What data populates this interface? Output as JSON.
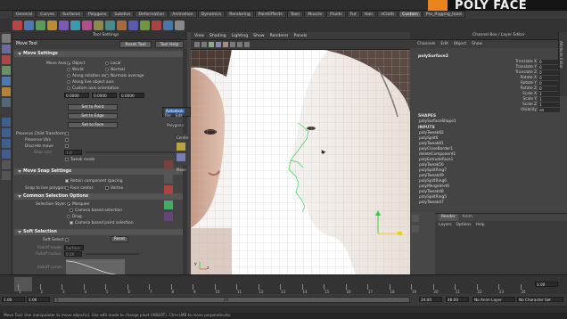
{
  "brand": {
    "logo_text": "POLY FACE",
    "accent": "#e9831e"
  },
  "shelf": {
    "tabs": [
      "General",
      "Curves",
      "Surfaces",
      "Polygons",
      "Subdivs",
      "Deformation",
      "Animation",
      "Dynamics",
      "Rendering",
      "PaintEffects",
      "Toon",
      "Muscle",
      "Fluids",
      "Fur",
      "Hair",
      "nCloth",
      "Custom",
      "Pro_Rigging_tools"
    ],
    "active_tab": "Custom"
  },
  "tool_settings": {
    "panel_title": "Tool Settings",
    "tool_name": "Move Tool",
    "reset_label": "Reset Tool",
    "help_label": "Tool Help",
    "move_settings": {
      "header": "Move Settings",
      "move_axis_label": "Move Axis:",
      "axis_options": [
        "Object",
        "World",
        "Along rotation axis",
        "Along live object axis",
        "Custom axis orientation"
      ],
      "axis_options_right": [
        "Local",
        "Normal",
        "Normals average"
      ],
      "custom_values": [
        "0.0000",
        "0.0000",
        "0.0000"
      ],
      "set_to_point": "Set to Point",
      "set_to_edge": "Set to Edge",
      "set_to_face": "Set to Face",
      "preserve_child": "Preserve Child Transform",
      "preserve_uvs": "Preserve UVs",
      "discrete_move": "Discrete move",
      "step_size_label": "Step size",
      "step_size_value": "1.0",
      "tweak_mode": "Tweak mode"
    },
    "move_snap": {
      "header": "Move Snap Settings",
      "retain_spacing": "Retain component spacing",
      "snap_live_label": "Snap to live polygon:",
      "face_center": "Face center",
      "vertex": "Vertex"
    },
    "common_selection": {
      "header": "Common Selection Options",
      "selection_style_label": "Selection Style:",
      "marquee": "Marquee",
      "camera_based": "Camera based selection",
      "drag": "Drag",
      "camera_based_paint": "Camera based paint selection"
    },
    "soft_selection": {
      "header": "Soft Selection",
      "soft_select": "Soft Select",
      "reset": "Reset",
      "falloff_mode_label": "Falloff mode:",
      "falloff_mode_value": "Surface",
      "falloff_radius_label": "Falloff radius:",
      "falloff_radius_value": "0.50",
      "falloff_curve_label": "Falloff curve:"
    }
  },
  "viewport": {
    "menus": [
      "View",
      "Shading",
      "Lighting",
      "Show",
      "Renderer",
      "Panels"
    ],
    "axis_y": "y",
    "axis_x": "x",
    "axis_z": "z"
  },
  "floating_menu": {
    "title": "Autodesk",
    "items": [
      "File",
      "Edit"
    ],
    "polygons": "Polygons",
    "center": "Center",
    "move": "Move"
  },
  "channel_box": {
    "title": "Channel Box / Layer Editor",
    "menus": [
      "Channels",
      "Edit",
      "Object",
      "Show"
    ],
    "object": "polySurface2",
    "attributes": [
      {
        "name": "Translate X",
        "value": "0"
      },
      {
        "name": "Translate Y",
        "value": "0"
      },
      {
        "name": "Translate Z",
        "value": "0"
      },
      {
        "name": "Rotate X",
        "value": "0"
      },
      {
        "name": "Rotate Y",
        "value": "0"
      },
      {
        "name": "Rotate Z",
        "value": "0"
      },
      {
        "name": "Scale X",
        "value": "1"
      },
      {
        "name": "Scale Y",
        "value": "1"
      },
      {
        "name": "Scale Z",
        "value": "1"
      },
      {
        "name": "Visibility",
        "value": "on"
      }
    ],
    "shapes_label": "SHAPES",
    "shape": "polySurfaceShape1",
    "inputs_label": "INPUTS",
    "inputs": [
      "polyTweak82",
      "polySplit6",
      "polyTweak81",
      "polyCloseBorder1",
      "deleteComponent1",
      "polyExtrudeFace1",
      "polyTweak56",
      "polySplitRing7",
      "polyTweak49",
      "polySplitRing6",
      "polyMergeVert6",
      "polyTweak48",
      "polySplitRing5",
      "polyTweak47"
    ],
    "side_tab": "Attribute Editor"
  },
  "layer_editor": {
    "tabs": [
      "Render",
      "Anim"
    ],
    "menus": [
      "Layers",
      "Options",
      "Help"
    ]
  },
  "timeline": {
    "ticks": [
      "1",
      "2",
      "3",
      "4",
      "5",
      "6",
      "7",
      "8",
      "9",
      "10",
      "11",
      "12",
      "13",
      "14",
      "15",
      "16",
      "17",
      "18",
      "19",
      "20",
      "21",
      "22",
      "23",
      "24"
    ],
    "current_frame": "1.00"
  },
  "range": {
    "start": "1.00",
    "inner_start": "1.00",
    "slider_start": "1",
    "slider_end": "24",
    "end": "24.00",
    "outer_end": "48.00",
    "anim_layer": "No Anim Layer",
    "char_set": "No Character Set"
  },
  "help_line": "Move Tool: Use manipulator to move object(s). Use edit mode to change pivot (INSERT). Ctrl+LMB to move perpendicular."
}
